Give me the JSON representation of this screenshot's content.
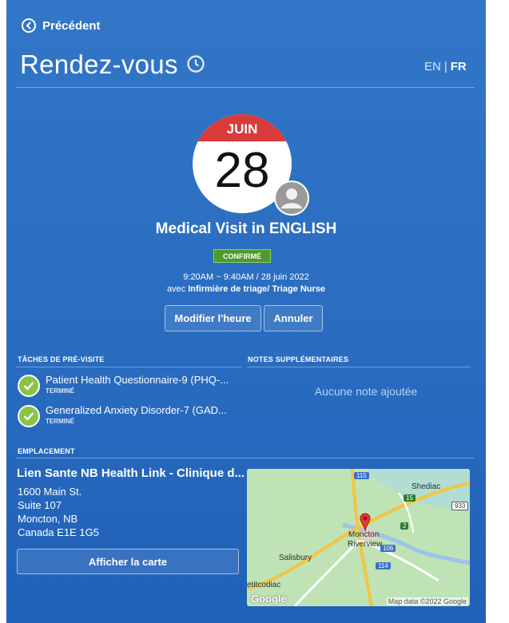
{
  "header": {
    "back_label": "Précédent",
    "page_title": "Rendez-vous",
    "lang_en": "EN",
    "lang_sep": "|",
    "lang_fr": "FR"
  },
  "appointment": {
    "month": "JUIN",
    "day": "28",
    "title": "Medical Visit in ENGLISH",
    "status": "CONFIRMÉ",
    "time": "9:20AM ~ 9:40AM / 28 juin 2022",
    "with_prefix": "avec",
    "provider": "Infirmière de triage/ Triage Nurse",
    "modify_label": "Modifier l'heure",
    "cancel_label": "Annuler"
  },
  "tasks": {
    "heading": "TÂCHES DE PRÉ-VISITE",
    "items": [
      {
        "name": "Patient Health Questionnaire-9 (PHQ-...",
        "status": "TERMINÉ"
      },
      {
        "name": "Generalized Anxiety Disorder-7 (GAD...",
        "status": "TERMINÉ"
      }
    ]
  },
  "notes": {
    "heading": "NOTES SUPPLÉMENTAIRES",
    "empty_text": "Aucune note ajoutée"
  },
  "location": {
    "heading": "EMPLACEMENT",
    "name": "Lien Sante NB Health Link - Clinique d...",
    "address": [
      "1600 Main St.",
      "Suite 107",
      "Moncton, NB",
      "Canada E1E 1G5"
    ],
    "map_button_label": "Afficher la carte"
  },
  "map": {
    "labels": {
      "shediac": "Shediac",
      "moncton": "Moncton",
      "riverview": "Riverview",
      "salisbury": "Salisbury",
      "petitcodiac": "etitcodiac"
    },
    "shields": {
      "r115": "115",
      "r15": "15",
      "r933": "933",
      "r2": "2",
      "r106": "106",
      "r114": "114"
    },
    "google": "Google",
    "attribution": "Map data ©2022 Google"
  },
  "colors": {
    "panel": "#2a6cc0",
    "calendar_band": "#d93a3a",
    "confirmed": "#4e9a2b",
    "check": "#8bc34a"
  }
}
